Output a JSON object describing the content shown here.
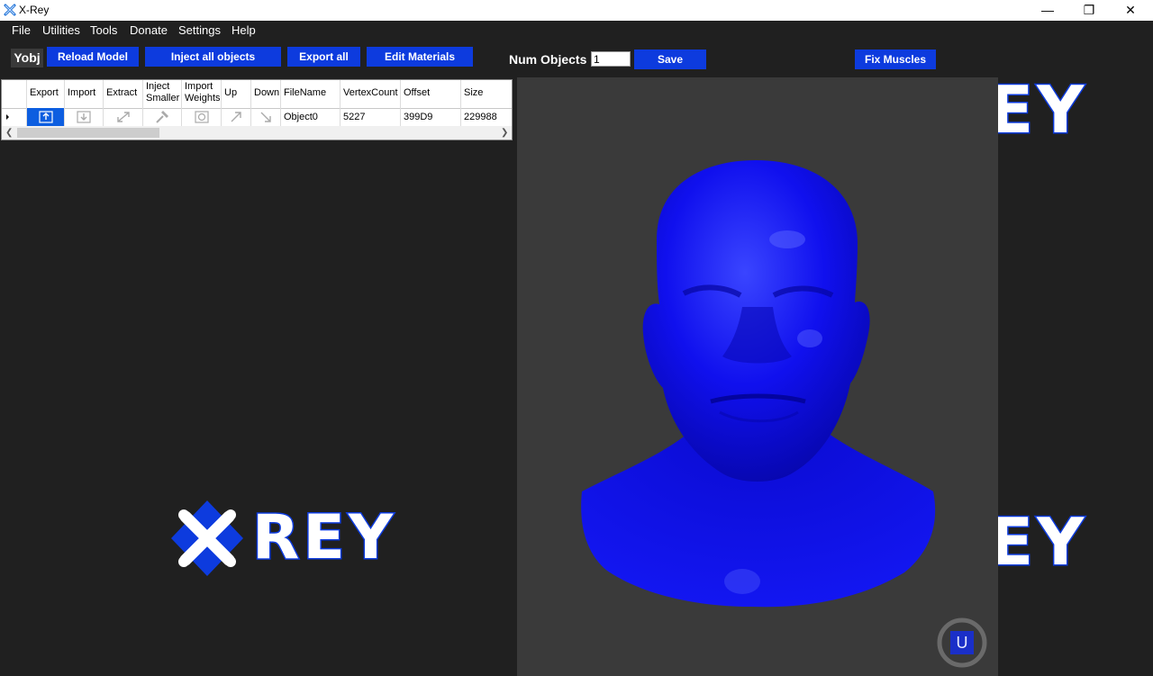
{
  "window": {
    "title": "X-Rey",
    "minimize": "—",
    "restore": "❐",
    "close": "✕"
  },
  "menu": [
    "File",
    "Utilities",
    "Tools",
    "Donate",
    "Settings",
    "Help"
  ],
  "toolbar": {
    "yobj": "Yobj",
    "reload_model": "Reload Model",
    "inject_all": "Inject all objects",
    "export_all": "Export all",
    "edit_materials": "Edit Materials",
    "num_objects_label": "Num Objects",
    "num_objects_value": "1",
    "save": "Save",
    "fix_muscles": "Fix Muscles"
  },
  "grid": {
    "columns": [
      "Export",
      "Import",
      "Extract",
      "Inject\nSmaller",
      "Import\nWeights",
      "Up",
      "Down",
      "FileName",
      "VertexCount",
      "Offset",
      "Size"
    ],
    "rows": [
      {
        "filename": "Object0",
        "vertex_count": "5227",
        "offset": "399D9",
        "size": "229988"
      }
    ]
  },
  "logo": {
    "text_left": "REY",
    "text_right_top": "EY",
    "text_right_bottom": "EY",
    "x_mark": "X"
  },
  "colors": {
    "accent": "#0d3bde",
    "background": "#202020",
    "viewport": "#3a3a3a",
    "model": "#0f10ee"
  },
  "viewport_badge": "U"
}
